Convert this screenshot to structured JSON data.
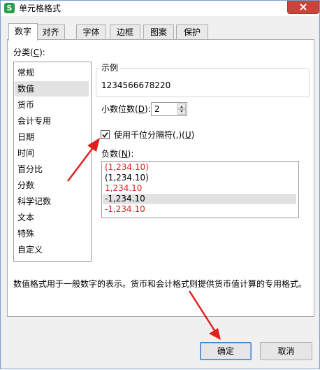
{
  "window": {
    "title": "单元格格式",
    "app_icon_glyph": "S",
    "close_icon": "close-icon"
  },
  "tabs": [
    {
      "label": "数字",
      "active": true
    },
    {
      "label": "对齐",
      "active": false
    },
    {
      "label": "字体",
      "active": false
    },
    {
      "label": "边框",
      "active": false
    },
    {
      "label": "图案",
      "active": false
    },
    {
      "label": "保护",
      "active": false
    }
  ],
  "category": {
    "label_prefix": "分类(",
    "label_key": "C",
    "label_suffix": "):",
    "items": [
      "常规",
      "数值",
      "货币",
      "会计专用",
      "日期",
      "时间",
      "百分比",
      "分数",
      "科学记数",
      "文本",
      "特殊",
      "自定义"
    ],
    "selected": "数值"
  },
  "sample": {
    "legend": "示例",
    "value": "1234566678220"
  },
  "decimal": {
    "label_prefix": "小数位数(",
    "label_key": "D",
    "label_suffix": "):",
    "value": "2"
  },
  "thousands": {
    "label_prefix": "使用千位分隔符(,)(",
    "label_key": "U",
    "label_suffix": ")",
    "checked": true
  },
  "negative": {
    "label_prefix": "负数(",
    "label_key": "N",
    "label_suffix": "):",
    "items": [
      {
        "text": "(1,234.10)",
        "color": "#e02020"
      },
      {
        "text": "(1,234.10)",
        "color": "#000000"
      },
      {
        "text": "1,234.10",
        "color": "#e02020"
      },
      {
        "text": "-1,234.10",
        "color": "#000000"
      },
      {
        "text": "-1,234.10",
        "color": "#e02020"
      }
    ],
    "selected_index": 3
  },
  "description": "数值格式用于一般数字的表示。货币和会计格式则提供货币值计算的专用格式。",
  "buttons": {
    "ok": "确定",
    "cancel": "取消"
  },
  "colors": {
    "accent_arrow": "#e02020",
    "title_icon": "#2a9d4a",
    "close_button": "#c9453a"
  }
}
